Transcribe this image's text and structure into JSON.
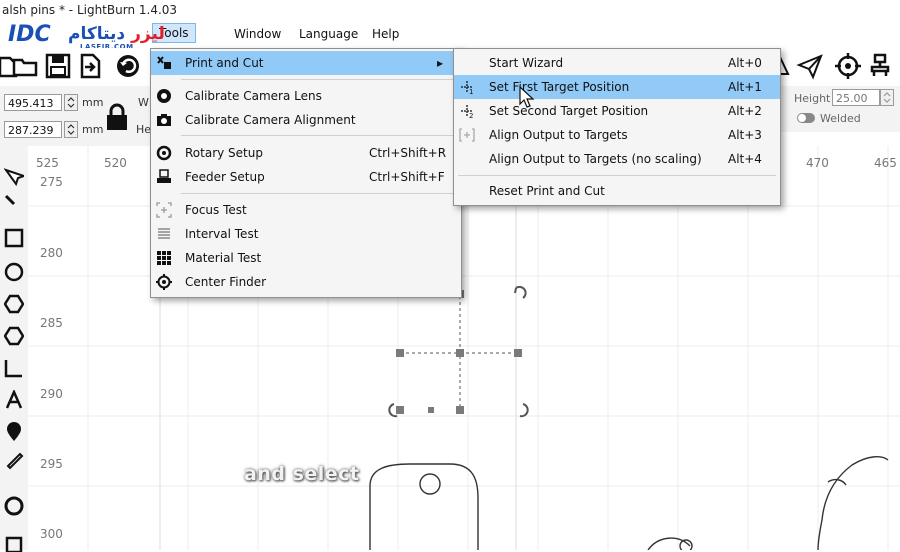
{
  "window": {
    "title": "alsh pins * - LightBurn 1.4.03"
  },
  "logo": {
    "brand": "IDC",
    "farsi_a": "دیتاکام",
    "farsi_b": "لیزر",
    "sub": "LASEIR.COM"
  },
  "menubar": {
    "items": [
      {
        "label": "Tools",
        "active": true
      },
      {
        "label": "Window"
      },
      {
        "label": "Language"
      },
      {
        "label": "Help"
      }
    ]
  },
  "position_panel": {
    "x_value": "495.413",
    "y_value": "287.239",
    "unit": "mm",
    "w_label": "W",
    "h_label": "He"
  },
  "right_panel": {
    "height_label": "Height",
    "height_value": "25.00",
    "welded_label": "Welded"
  },
  "tools_menu": {
    "items": [
      {
        "label": "Print and Cut",
        "icon": "print-cut-icon",
        "submenu": true,
        "highlighted": true
      },
      {
        "label": "Calibrate Camera Lens",
        "icon": "camera-lens-icon"
      },
      {
        "label": "Calibrate Camera Alignment",
        "icon": "camera-icon"
      },
      {
        "label": "Rotary Setup",
        "icon": "rotary-icon",
        "shortcut": "Ctrl+Shift+R"
      },
      {
        "label": "Feeder Setup",
        "icon": "feeder-icon",
        "shortcut": "Ctrl+Shift+F"
      },
      {
        "label": "Focus Test",
        "icon": "focus-test-icon"
      },
      {
        "label": "Interval Test",
        "icon": "interval-test-icon"
      },
      {
        "label": "Material Test",
        "icon": "material-test-icon"
      },
      {
        "label": "Center Finder",
        "icon": "center-finder-icon"
      }
    ]
  },
  "print_cut_menu": {
    "items": [
      {
        "label": "Start Wizard",
        "shortcut": "Alt+0"
      },
      {
        "label": "Set First Target Position",
        "shortcut": "Alt+1",
        "icon": "target-one-icon",
        "highlighted": true
      },
      {
        "label": "Set Second Target Position",
        "shortcut": "Alt+2",
        "icon": "target-two-icon"
      },
      {
        "label": "Align Output to Targets",
        "shortcut": "Alt+3",
        "icon": "align-targets-icon"
      },
      {
        "label": "Align Output to Targets (no scaling)",
        "shortcut": "Alt+4"
      },
      {
        "label": "Reset Print and Cut"
      }
    ]
  },
  "ruler": {
    "top": [
      "525",
      "520",
      "470",
      "465"
    ],
    "left": [
      "275",
      "280",
      "285",
      "290",
      "295",
      "300"
    ]
  },
  "caption": "and select"
}
